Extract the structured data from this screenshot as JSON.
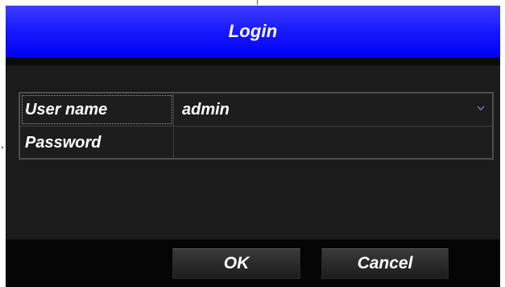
{
  "dialog": {
    "title": "Login"
  },
  "form": {
    "username": {
      "label": "User name",
      "value": "admin"
    },
    "password": {
      "label": "Password",
      "value": ""
    }
  },
  "buttons": {
    "ok_label": "OK",
    "cancel_label": "Cancel"
  },
  "colors": {
    "titlebar": "#0000f2",
    "dialog_background": "#1b1b1b",
    "footer_background": "#050505",
    "text": "#ffffff",
    "chevron": "#6f7fd0"
  }
}
